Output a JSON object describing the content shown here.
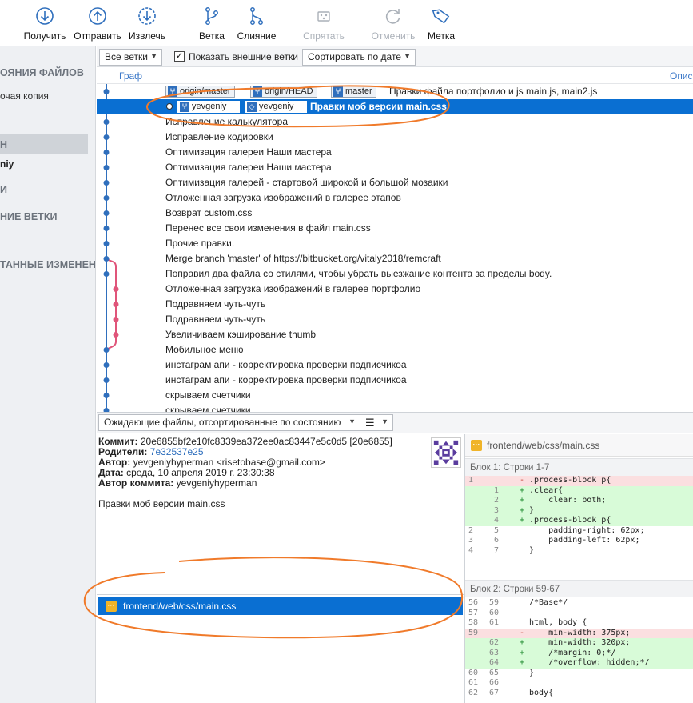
{
  "toolbar": {
    "buttons": [
      {
        "label": "Получить",
        "icon": "pull-icon"
      },
      {
        "label": "Отправить",
        "icon": "push-icon"
      },
      {
        "label": "Извлечь",
        "icon": "fetch-icon"
      },
      {
        "label": "Ветка",
        "icon": "branch-icon"
      },
      {
        "label": "Слияние",
        "icon": "merge-icon"
      },
      {
        "label": "Спрятать",
        "icon": "stash-icon"
      },
      {
        "label": "Отменить",
        "icon": "discard-icon"
      },
      {
        "label": "Метка",
        "icon": "tag-icon"
      }
    ]
  },
  "sidebar": {
    "file_status": "ОЯНИЯ ФАЙЛОВ",
    "working_copy": "очая копия",
    "branches_cut": "H",
    "current_branch": "niy",
    "tags_cut": "И",
    "remote_branches": "НИЕ ВЕТКИ",
    "stashes": "ТАННЫЕ ИЗМЕНЕН"
  },
  "filters": {
    "branches": "Все ветки",
    "show_remote_label": "Показать внешние ветки",
    "show_remote_checked": true,
    "sort": "Сортировать по дате"
  },
  "graph_header": {
    "graph": "Граф",
    "description": "Опис"
  },
  "commits": [
    {
      "message": "Правки файла портфолио и js main.js, main2.js",
      "tags": [
        "origin/master",
        "origin/HEAD",
        "master"
      ]
    },
    {
      "message": "Правки моб версии main.css",
      "tags": [
        "yevgeniy",
        "yevgeniy"
      ],
      "selected": true
    },
    {
      "message": "Исправление калькулятора"
    },
    {
      "message": "Исправление кодировки"
    },
    {
      "message": "Оптимизация галереи Наши мастера"
    },
    {
      "message": "Оптимизация галереи Наши мастера"
    },
    {
      "message": "Оптимизация галерей - стартовой широкой и большой мозаики"
    },
    {
      "message": "Отложенная загрузка изображений в галерее этапов"
    },
    {
      "message": "Возврат custom.css"
    },
    {
      "message": "Перенес все свои изменения в файл main.css"
    },
    {
      "message": "Прочие правки."
    },
    {
      "message": "Merge branch 'master' of https://bitbucket.org/vitaly2018/remcraft"
    },
    {
      "message": "Поправил два файла со стилями, чтобы убрать выезжание контента за пределы body."
    },
    {
      "message": "Отложенная загрузка изображений в галерее портфолио"
    },
    {
      "message": "Подравняем чуть-чуть"
    },
    {
      "message": "Подравняем чуть-чуть"
    },
    {
      "message": "Увеличиваем кэширование thumb"
    },
    {
      "message": "Мобильное меню"
    },
    {
      "message": "инстаграм апи - корректировка проверки подписчикоа"
    },
    {
      "message": "инстаграм апи - корректировка проверки подписчикоа"
    },
    {
      "message": "скрываем счетчики"
    },
    {
      "message": "скрываем счетчики"
    }
  ],
  "bottom_bar": {
    "pending_files": "Ожидающие файлы, отсортированные по состоянию"
  },
  "details": {
    "commit_label": "Коммит:",
    "commit_value": "20e6855bf2e10fc8339ea372ee0ac83447e5c0d5 [20e6855]",
    "parents_label": "Родители:",
    "parents_value": "7e32537e25",
    "author_label": "Автор:",
    "author_value": "yevgeniyhyperman <risetobase@gmail.com>",
    "date_label": "Дата:",
    "date_value": "среда, 10 апреля 2019 г. 23:30:38",
    "committer_label": "Автор коммита:",
    "committer_value": "yevgeniyhyperman",
    "message": "Правки моб версии main.css"
  },
  "files": [
    {
      "path": "frontend/web/css/main.css",
      "icon": "modified-icon"
    }
  ],
  "diff": {
    "file": "frontend/web/css/main.css",
    "hunk1_title": "Блок 1: Строки 1-7",
    "hunk1_lines": [
      {
        "old": "1",
        "new": "",
        "sign": "-",
        "text": ".process-block p{",
        "type": "del"
      },
      {
        "old": "",
        "new": "1",
        "sign": "+",
        "text": ".clear{",
        "type": "add"
      },
      {
        "old": "",
        "new": "2",
        "sign": "+",
        "text": "    clear: both;",
        "type": "add"
      },
      {
        "old": "",
        "new": "3",
        "sign": "+",
        "text": "}",
        "type": "add"
      },
      {
        "old": "",
        "new": "4",
        "sign": "+",
        "text": ".process-block p{",
        "type": "add"
      },
      {
        "old": "2",
        "new": "5",
        "sign": "",
        "text": "    padding-right: 62px;",
        "type": "ctx"
      },
      {
        "old": "3",
        "new": "6",
        "sign": "",
        "text": "    padding-left: 62px;",
        "type": "ctx"
      },
      {
        "old": "4",
        "new": "7",
        "sign": "",
        "text": "}",
        "type": "ctx"
      }
    ],
    "hunk2_title": "Блок 2: Строки 59-67",
    "hunk2_lines": [
      {
        "old": "56",
        "new": "59",
        "sign": "",
        "text": "/*Base*/",
        "type": "ctx"
      },
      {
        "old": "57",
        "new": "60",
        "sign": "",
        "text": "",
        "type": "ctx"
      },
      {
        "old": "58",
        "new": "61",
        "sign": "",
        "text": "html, body {",
        "type": "ctx"
      },
      {
        "old": "59",
        "new": "",
        "sign": "-",
        "text": "    min-width: 375px;",
        "type": "del"
      },
      {
        "old": "",
        "new": "62",
        "sign": "+",
        "text": "    min-width: 320px;",
        "type": "add"
      },
      {
        "old": "",
        "new": "63",
        "sign": "+",
        "text": "    /*margin: 0;*/",
        "type": "add"
      },
      {
        "old": "",
        "new": "64",
        "sign": "+",
        "text": "    /*overflow: hidden;*/",
        "type": "add"
      },
      {
        "old": "60",
        "new": "65",
        "sign": "",
        "text": "}",
        "type": "ctx"
      },
      {
        "old": "61",
        "new": "66",
        "sign": "",
        "text": "",
        "type": "ctx"
      },
      {
        "old": "62",
        "new": "67",
        "sign": "",
        "text": "body{",
        "type": "ctx"
      }
    ]
  },
  "colors": {
    "accent": "#0a6fd2",
    "graph_main": "#2f6fbd",
    "graph_branch": "#e0557a",
    "annotation": "#f07a2a"
  }
}
